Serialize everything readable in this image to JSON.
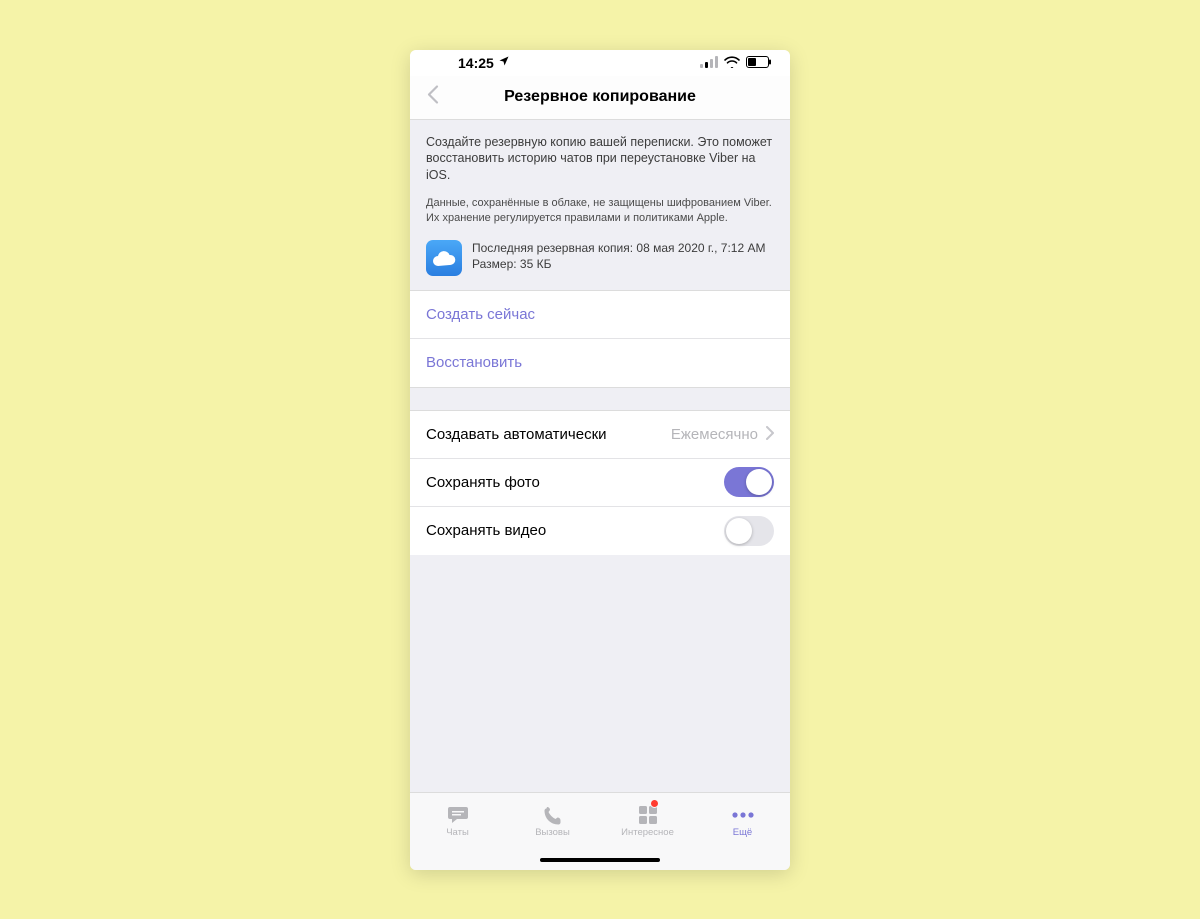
{
  "statusbar": {
    "time": "14:25"
  },
  "header": {
    "title": "Резервное копирование"
  },
  "info": {
    "main": "Создайте резервную копию вашей переписки. Это поможет восстановить историю чатов при переустановке Viber на iOS.",
    "fine": "Данные, сохранённые в облаке, не защищены шифрованием Viber. Их хранение регулируется правилами и политиками Apple.",
    "last_backup_line": "Последняя резервная копия: 08 мая 2020 г., 7:12 AM",
    "size_line": "Размер: 35 КБ"
  },
  "actions": {
    "create_now": "Создать сейчас",
    "restore": "Восстановить"
  },
  "settings": {
    "auto_label": "Создавать автоматически",
    "auto_value": "Ежемесячно",
    "save_photo_label": "Сохранять фото",
    "save_photo_on": true,
    "save_video_label": "Сохранять видео",
    "save_video_on": false
  },
  "tabs": {
    "chats": "Чаты",
    "calls": "Вызовы",
    "explore": "Интересное",
    "more": "Ещё"
  }
}
